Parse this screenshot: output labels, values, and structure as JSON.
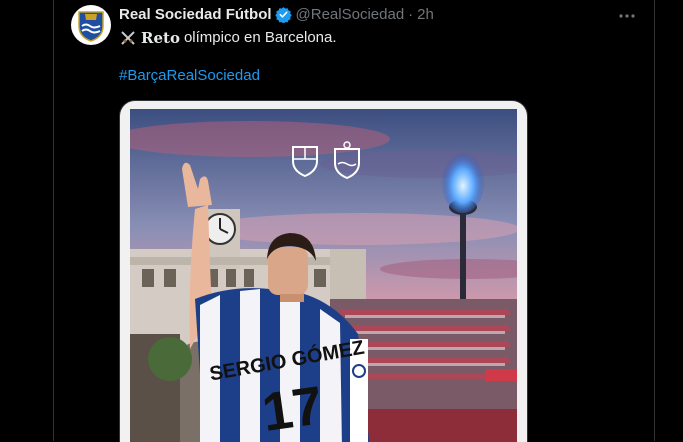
{
  "tweet": {
    "author_name": "Real Sociedad Fútbol",
    "handle": "@RealSociedad",
    "separator": "·",
    "time": "2h",
    "text_bold": "Reto",
    "text_rest": "olímpico en Barcelona.",
    "hashtag": "#BarçaRealSociedad"
  },
  "image": {
    "jersey_name": "SERGIO GÓMEZ",
    "jersey_number": "17"
  },
  "icons": {
    "verified": "verified-badge-icon",
    "more": "more-options-icon",
    "emoji": "crossed-swords-icon"
  },
  "colors": {
    "background": "#000000",
    "text": "#e7e9ea",
    "muted": "#71767b",
    "link": "#1d9bf0",
    "verified": "#1d9bf0"
  }
}
